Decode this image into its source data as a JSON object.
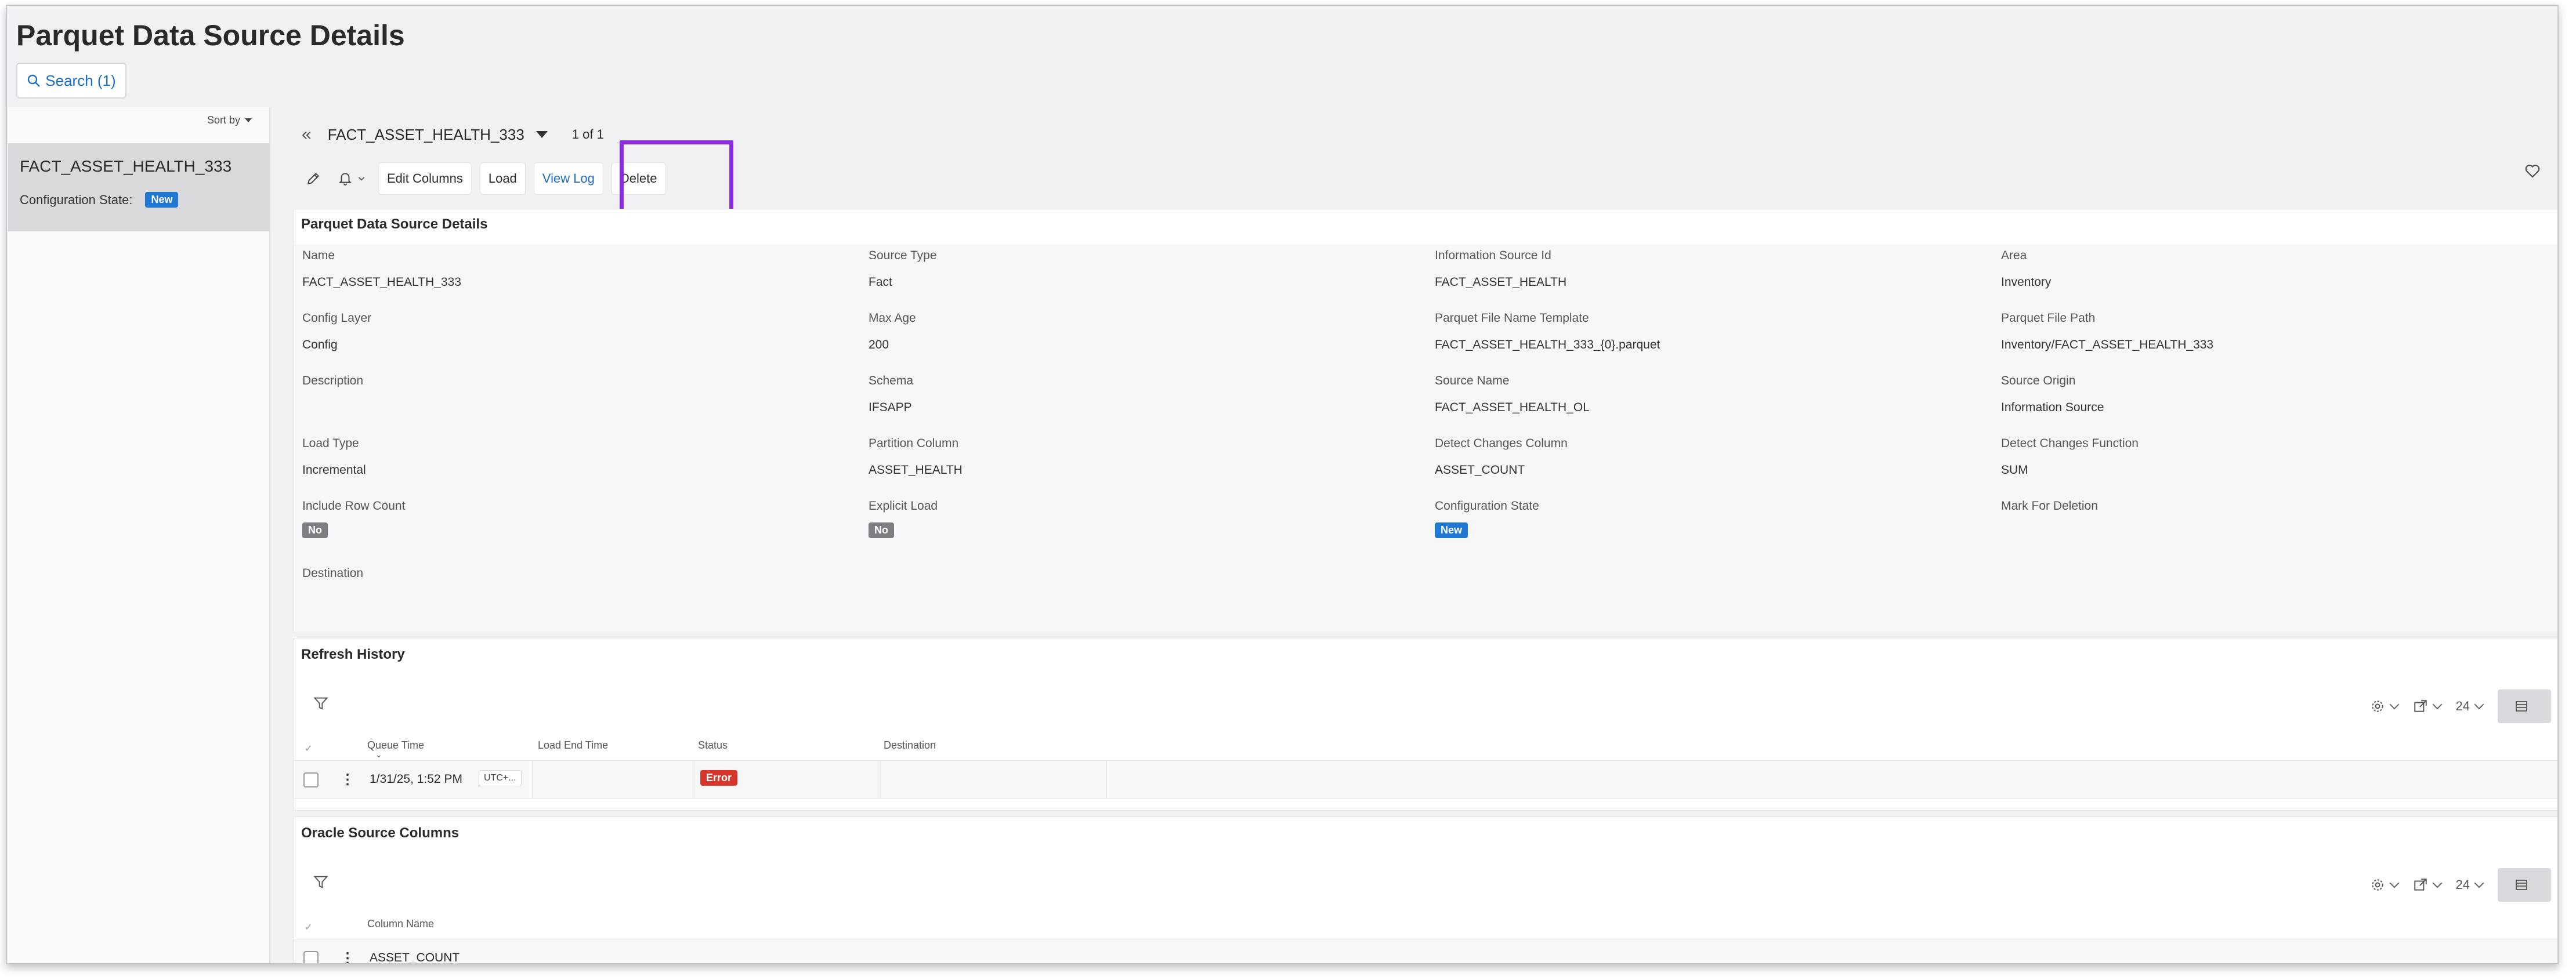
{
  "page": {
    "title": "Parquet Data Source Details",
    "search_label": "Search (1)"
  },
  "left_list": {
    "sort_label": "Sort by",
    "items": [
      {
        "name": "FACT_ASSET_HEALTH_333",
        "state_label": "Configuration State:",
        "state_badge": "New"
      }
    ]
  },
  "record_nav": {
    "current": "FACT_ASSET_HEALTH_333",
    "count": "1 of 1"
  },
  "toolbar": {
    "edit_columns": "Edit Columns",
    "load": "Load",
    "view_log": "View Log",
    "delete": "Delete"
  },
  "details": {
    "title": "Parquet Data Source Details",
    "fields": [
      {
        "label": "Name",
        "value": "FACT_ASSET_HEALTH_333"
      },
      {
        "label": "Source Type",
        "value": "Fact"
      },
      {
        "label": "Information Source Id",
        "value": "FACT_ASSET_HEALTH"
      },
      {
        "label": "Area",
        "value": "Inventory"
      },
      {
        "label": "Config Layer",
        "value": "Config"
      },
      {
        "label": "Max Age",
        "value": "200"
      },
      {
        "label": "Parquet File Name Template",
        "value": "FACT_ASSET_HEALTH_333_{0}.parquet"
      },
      {
        "label": "Parquet File Path",
        "value": "Inventory/FACT_ASSET_HEALTH_333"
      },
      {
        "label": "Description",
        "value": ""
      },
      {
        "label": "Schema",
        "value": "IFSAPP"
      },
      {
        "label": "Source Name",
        "value": "FACT_ASSET_HEALTH_OL"
      },
      {
        "label": "Source Origin",
        "value": "Information Source"
      },
      {
        "label": "Load Type",
        "value": "Incremental"
      },
      {
        "label": "Partition Column",
        "value": "ASSET_HEALTH"
      },
      {
        "label": "Detect Changes Column",
        "value": "ASSET_COUNT"
      },
      {
        "label": "Detect Changes Function",
        "value": "SUM"
      },
      {
        "label": "Include Row Count",
        "badge": "No"
      },
      {
        "label": "Explicit Load",
        "badge": "No"
      },
      {
        "label": "Configuration State",
        "badge": "New"
      },
      {
        "label": "Mark For Deletion",
        "value": ""
      },
      {
        "label": "Destination",
        "value": ""
      }
    ]
  },
  "refresh_history": {
    "title": "Refresh History",
    "page_size": "24",
    "columns": [
      "Queue Time",
      "Load End Time",
      "Status",
      "Destination"
    ],
    "rows": [
      {
        "queue_time": "1/31/25, 1:52 PM",
        "tz": "UTC+...",
        "load_end_time": "",
        "status": "Error",
        "destination": ""
      }
    ]
  },
  "oracle_columns": {
    "title": "Oracle Source Columns",
    "page_size": "24",
    "columns": [
      "Column Name"
    ],
    "rows": [
      {
        "column_name": "ASSET_COUNT"
      }
    ]
  },
  "colors": {
    "accent": "#1b6ec2",
    "badge_new": "#1f78d1",
    "badge_no": "#7d7d82",
    "badge_error": "#d6362b",
    "highlight": "#8b2be2"
  }
}
